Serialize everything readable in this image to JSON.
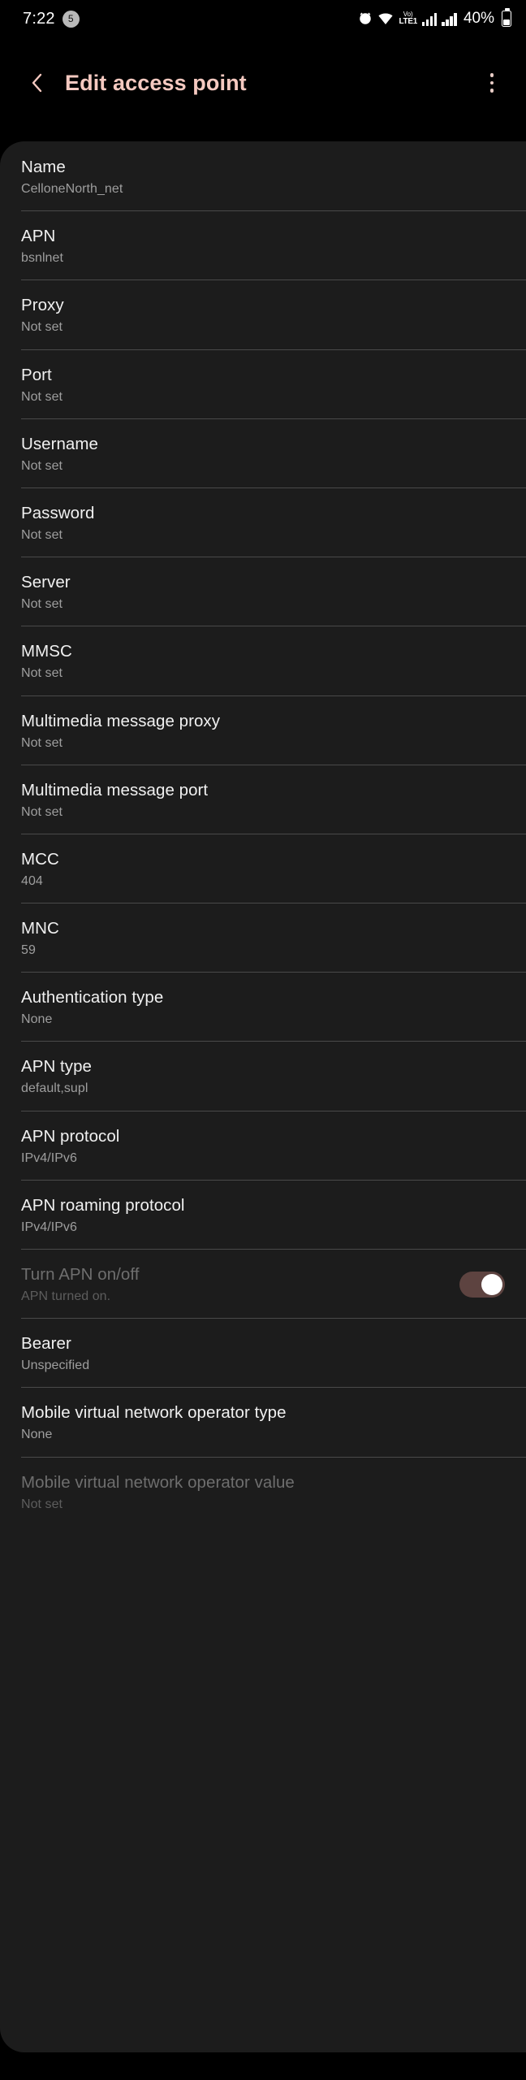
{
  "status_bar": {
    "time": "7:22",
    "notification_count": "5",
    "icons": [
      "alarm-icon",
      "wifi-icon",
      "volte-icon",
      "signal-icon-sim1",
      "signal-icon-sim2"
    ],
    "volte_top": "Vo)",
    "volte_bottom": "LTE1",
    "battery_percent": "40%"
  },
  "toolbar": {
    "back_icon": "chevron-left-icon",
    "title": "Edit access point",
    "overflow_icon": "more-vertical-icon",
    "accent_color": "#f5c9c0"
  },
  "preferences": [
    {
      "title": "Name",
      "summary": "CelloneNorth_net",
      "disabled": false,
      "type": "text"
    },
    {
      "title": "APN",
      "summary": "bsnlnet",
      "disabled": false,
      "type": "text"
    },
    {
      "title": "Proxy",
      "summary": "Not set",
      "disabled": false,
      "type": "text"
    },
    {
      "title": "Port",
      "summary": "Not set",
      "disabled": false,
      "type": "text"
    },
    {
      "title": "Username",
      "summary": "Not set",
      "disabled": false,
      "type": "text"
    },
    {
      "title": "Password",
      "summary": "Not set",
      "disabled": false,
      "type": "text"
    },
    {
      "title": "Server",
      "summary": "Not set",
      "disabled": false,
      "type": "text"
    },
    {
      "title": "MMSC",
      "summary": "Not set",
      "disabled": false,
      "type": "text"
    },
    {
      "title": "Multimedia message proxy",
      "summary": "Not set",
      "disabled": false,
      "type": "text"
    },
    {
      "title": "Multimedia message port",
      "summary": "Not set",
      "disabled": false,
      "type": "text"
    },
    {
      "title": "MCC",
      "summary": "404",
      "disabled": false,
      "type": "text"
    },
    {
      "title": "MNC",
      "summary": "59",
      "disabled": false,
      "type": "text"
    },
    {
      "title": "Authentication type",
      "summary": "None",
      "disabled": false,
      "type": "list"
    },
    {
      "title": "APN type",
      "summary": "default,supl",
      "disabled": false,
      "type": "text"
    },
    {
      "title": "APN protocol",
      "summary": "IPv4/IPv6",
      "disabled": false,
      "type": "list"
    },
    {
      "title": "APN roaming protocol",
      "summary": "IPv4/IPv6",
      "disabled": false,
      "type": "list"
    },
    {
      "title": "Turn APN on/off",
      "summary": "APN turned on.",
      "disabled": true,
      "type": "switch",
      "switch_on": true,
      "switch_track_color": "#5d4340",
      "switch_thumb_color": "#ffffff"
    },
    {
      "title": "Bearer",
      "summary": "Unspecified",
      "disabled": false,
      "type": "list"
    },
    {
      "title": "Mobile virtual network operator type",
      "summary": "None",
      "disabled": false,
      "type": "list"
    },
    {
      "title": "Mobile virtual network operator value",
      "summary": "Not set",
      "disabled": true,
      "type": "text"
    }
  ]
}
